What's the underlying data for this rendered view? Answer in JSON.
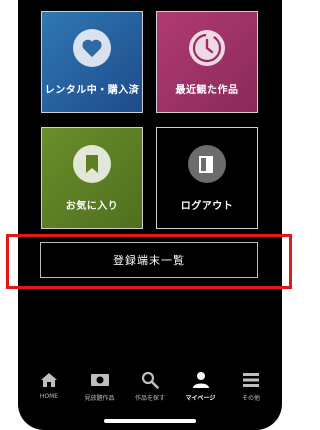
{
  "tiles": {
    "rental": {
      "label": "レンタル中・購入済",
      "icon": "heart-icon"
    },
    "recent": {
      "label": "最近観た作品",
      "icon": "clock-icon"
    },
    "favorites": {
      "label": "お気に入り",
      "icon": "bookmark-icon"
    },
    "logout": {
      "label": "ログアウト",
      "icon": "exit-door-icon"
    }
  },
  "device_list_label": "登録端末一覧",
  "tabbar": [
    {
      "label": "HOME",
      "icon": "home-icon",
      "active": false
    },
    {
      "label": "見放題作品",
      "icon": "tv-icon",
      "active": false
    },
    {
      "label": "作品を探す",
      "icon": "search-icon",
      "active": false
    },
    {
      "label": "マイページ",
      "icon": "person-icon",
      "active": true
    },
    {
      "label": "その他",
      "icon": "menu-icon",
      "active": false
    }
  ],
  "colors": {
    "rental": "#2f78b5",
    "recent": "#b13a74",
    "favorites": "#6a8e2a",
    "highlight": "#e01818"
  }
}
